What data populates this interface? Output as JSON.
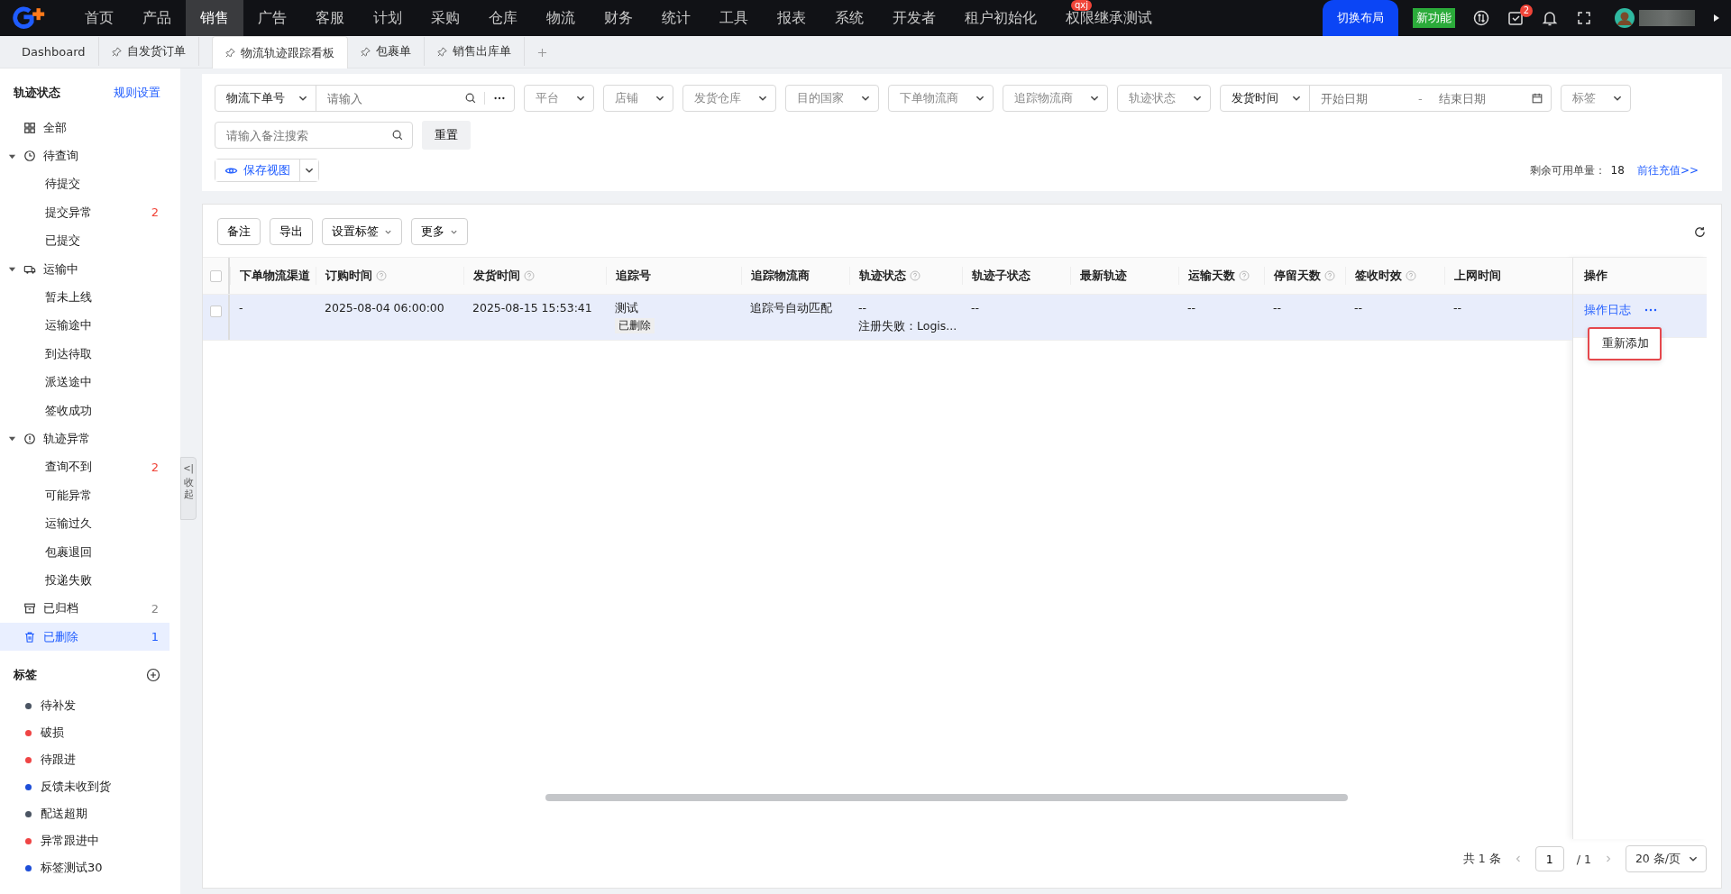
{
  "nav": {
    "items": [
      {
        "label": "首页",
        "selected": false
      },
      {
        "label": "产品",
        "selected": false
      },
      {
        "label": "销售",
        "selected": true
      },
      {
        "label": "广告",
        "selected": false
      },
      {
        "label": "客服",
        "selected": false
      },
      {
        "label": "计划",
        "selected": false
      },
      {
        "label": "采购",
        "selected": false
      },
      {
        "label": "仓库",
        "selected": false
      },
      {
        "label": "物流",
        "selected": false
      },
      {
        "label": "财务",
        "selected": false
      },
      {
        "label": "统计",
        "selected": false
      },
      {
        "label": "工具",
        "selected": false
      },
      {
        "label": "报表",
        "selected": false
      },
      {
        "label": "系统",
        "selected": false
      },
      {
        "label": "开发者",
        "selected": false
      },
      {
        "label": "租户初始化",
        "selected": false
      },
      {
        "label": "权限继承测试",
        "selected": false,
        "badge": "qxj"
      }
    ],
    "layout_button": "切换布局",
    "new_feature": "新功能",
    "task_badge": "2"
  },
  "tabs": [
    {
      "label": "Dashboard",
      "pinned": false,
      "selected": false
    },
    {
      "label": "自发货订单",
      "pinned": true,
      "selected": false
    },
    {
      "label": "物流轨迹跟踪看板",
      "pinned": true,
      "selected": true
    },
    {
      "label": "包裹单",
      "pinned": true,
      "selected": false
    },
    {
      "label": "销售出库单",
      "pinned": true,
      "selected": false
    }
  ],
  "sidebar": {
    "title": "轨迹状态",
    "settings_link": "规则设置",
    "collapse_label": "收起",
    "items": [
      {
        "label": "全部",
        "kind": "grid",
        "selected": false
      },
      {
        "label": "待查询",
        "kind": "clock",
        "expanded": true,
        "selected": false,
        "children": [
          {
            "label": "待提交",
            "selected": false
          },
          {
            "label": "提交异常",
            "count": "2",
            "alert": true,
            "selected": false
          },
          {
            "label": "已提交",
            "selected": false
          }
        ]
      },
      {
        "label": "运输中",
        "kind": "truck",
        "expanded": true,
        "selected": false,
        "children": [
          {
            "label": "暂未上线",
            "selected": false
          },
          {
            "label": "运输途中",
            "selected": false
          },
          {
            "label": "到达待取",
            "selected": false
          },
          {
            "label": "派送途中",
            "selected": false
          },
          {
            "label": "签收成功",
            "selected": false
          }
        ]
      },
      {
        "label": "轨迹异常",
        "kind": "alert",
        "expanded": true,
        "selected": false,
        "children": [
          {
            "label": "查询不到",
            "count": "2",
            "alert": true,
            "selected": false
          },
          {
            "label": "可能异常",
            "selected": false
          },
          {
            "label": "运输过久",
            "selected": false
          },
          {
            "label": "包裹退回",
            "selected": false
          },
          {
            "label": "投递失败",
            "selected": false
          }
        ]
      },
      {
        "label": "已归档",
        "kind": "archive",
        "count": "2",
        "alert": false,
        "selected": false
      },
      {
        "label": "已删除",
        "kind": "trash",
        "count": "1",
        "alert": false,
        "selected": true
      }
    ],
    "collapse_icon": "<|",
    "tags_title": "标签",
    "tags": [
      {
        "label": "待补发",
        "color": "#4b5563"
      },
      {
        "label": "破损",
        "color": "#ef4444"
      },
      {
        "label": "待跟进",
        "color": "#ef4444"
      },
      {
        "label": "反馈未收到货",
        "color": "#1d4ed8"
      },
      {
        "label": "配送超期",
        "color": "#4b5563"
      },
      {
        "label": "异常跟进中",
        "color": "#ef4444"
      },
      {
        "label": "标签测试30",
        "color": "#1d4ed8"
      }
    ]
  },
  "filters": {
    "search_type": "物流下单号",
    "search_placeholder": "请输入",
    "selects": [
      "平台",
      "店铺",
      "发货仓库",
      "目的国家",
      "下单物流商",
      "追踪物流商",
      "轨迹状态"
    ],
    "date_type": "发货时间",
    "start_placeholder": "开始日期",
    "date_separator": "-",
    "end_placeholder": "结束日期",
    "tag_select": "标签",
    "note_placeholder": "请输入备注搜索",
    "reset": "重置",
    "save_view": "保存视图",
    "quota_label": "剩余可用单量：",
    "quota_value": "18",
    "recharge_link": "前往充值>>"
  },
  "toolbar": [
    {
      "label": "备注",
      "dropdown": false
    },
    {
      "label": "导出",
      "dropdown": false
    },
    {
      "label": "设置标签",
      "dropdown": true
    },
    {
      "label": "更多",
      "dropdown": true
    }
  ],
  "table": {
    "columns": [
      {
        "label": "下单物流渠道",
        "help": false
      },
      {
        "label": "订购时间",
        "help": true
      },
      {
        "label": "发货时间",
        "help": true
      },
      {
        "label": "追踪号",
        "help": false
      },
      {
        "label": "追踪物流商",
        "help": false
      },
      {
        "label": "轨迹状态",
        "help": true
      },
      {
        "label": "轨迹子状态",
        "help": false
      },
      {
        "label": "最新轨迹",
        "help": false
      },
      {
        "label": "运输天数",
        "help": true
      },
      {
        "label": "停留天数",
        "help": true
      },
      {
        "label": "签收时效",
        "help": true
      },
      {
        "label": "上网时间",
        "help": false
      }
    ],
    "action_column": "操作",
    "all_checked": false,
    "rows": [
      {
        "checked": false,
        "highlighted": true,
        "cells": [
          {
            "text": "-"
          },
          {
            "text": "2025-08-04 06:00:00"
          },
          {
            "text": "2025-08-15 15:53:41"
          },
          {
            "text": "测试",
            "tag": "已删除"
          },
          {
            "text": "追踪号自动匹配"
          },
          {
            "text": "--",
            "note": "注册失败：Logis..."
          },
          {
            "text": "--"
          },
          null,
          {
            "text": "--"
          },
          {
            "text": "--"
          },
          {
            "text": "--"
          },
          {
            "text": "--"
          }
        ],
        "action_link": "操作日志",
        "menu": [
          "重新添加"
        ]
      }
    ]
  },
  "pagination": {
    "total": "共 1 条",
    "page": "1",
    "pages": "/ 1",
    "page_size": "20 条/页"
  }
}
